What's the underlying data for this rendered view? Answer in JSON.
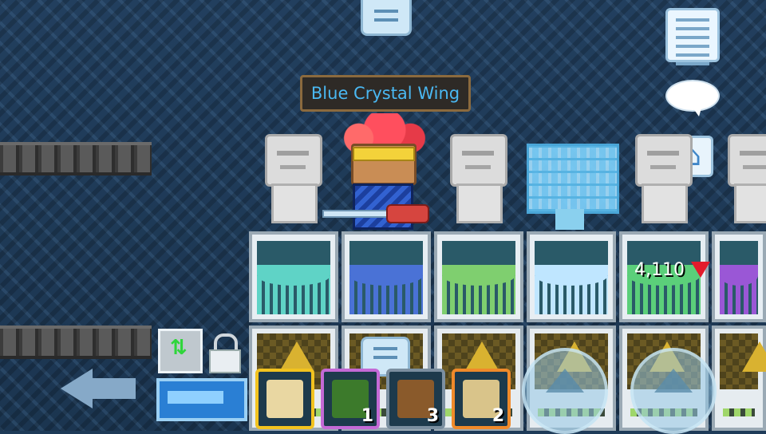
{
  "item_nameplate": "Blue Crystal Wing",
  "vending": {
    "price": "4,110",
    "colors": [
      "#5fd3c6",
      "#4a72d6",
      "#7fcf6f",
      "#bfe6ff",
      "#5bcf7a",
      "#9a57d6"
    ]
  },
  "hotbar": {
    "slots": [
      {
        "icon": "fist-icon",
        "count": "",
        "border": "#f2c31f",
        "fill": "#e9d7a2"
      },
      {
        "icon": "growtopia-guide-book-icon",
        "count": "1",
        "border": "#c46ad6",
        "fill": "#3c7a2b"
      },
      {
        "icon": "door-icon",
        "count": "3",
        "border": "#7b8fa0",
        "fill": "#8a5a2b"
      },
      {
        "icon": "small-lock-icon",
        "count": "2",
        "border": "#f08a2a",
        "fill": "#d9c48a"
      }
    ]
  },
  "icons": {
    "menu": "menu-icon",
    "list": "list-icon",
    "chat": "chat-bubble-icon",
    "home": "home-icon",
    "gem": "gem-icon",
    "left_arrow": "left-arrow-icon",
    "swap": "swap-arrows-icon",
    "lock": "lock-icon"
  },
  "home_glyph": "⌂",
  "swap_glyph": "⇅"
}
